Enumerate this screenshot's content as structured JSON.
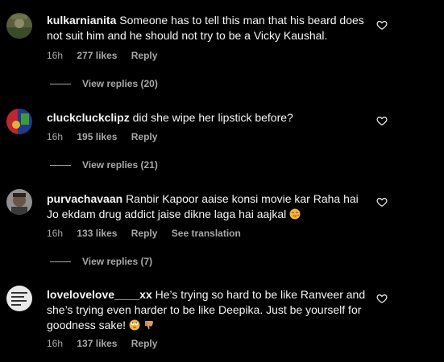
{
  "comments": [
    {
      "username": "kulkarnianita",
      "text": "Someone has to tell this man that his beard does not suit him and he should not try to be a Vicky Kaushal.",
      "time": "16h",
      "likes": "277 likes",
      "reply_label": "Reply",
      "view_replies": "View replies (20)"
    },
    {
      "username": "cluckcluckclipz",
      "text": "did she wipe her lipstick before?",
      "time": "16h",
      "likes": "195 likes",
      "reply_label": "Reply",
      "view_replies": "View replies (21)"
    },
    {
      "username": "purvachavaan",
      "text": "Ranbir Kapoor aaise konsi movie kar Raha hai Jo ekdam drug addict jaise dikne laga hai aajkal",
      "emoji": "face-with-heart-eyes-kiss",
      "time": "16h",
      "likes": "133 likes",
      "reply_label": "Reply",
      "translation_label": "See translation",
      "view_replies": "View replies (7)"
    },
    {
      "username": "lovelovelove____xx",
      "text": "He’s trying so hard to be like Ranveer and she’s trying even harder to be like Deepika. Just be yourself for goodness sake!",
      "emojis": [
        "face-rolling-eyes",
        "thumbs-down"
      ],
      "time": "16h",
      "likes": "137 likes",
      "reply_label": "Reply"
    }
  ],
  "colors": {
    "background": "#000000",
    "primary_text": "#f5f5f5",
    "secondary_text": "#a8a8a8"
  }
}
